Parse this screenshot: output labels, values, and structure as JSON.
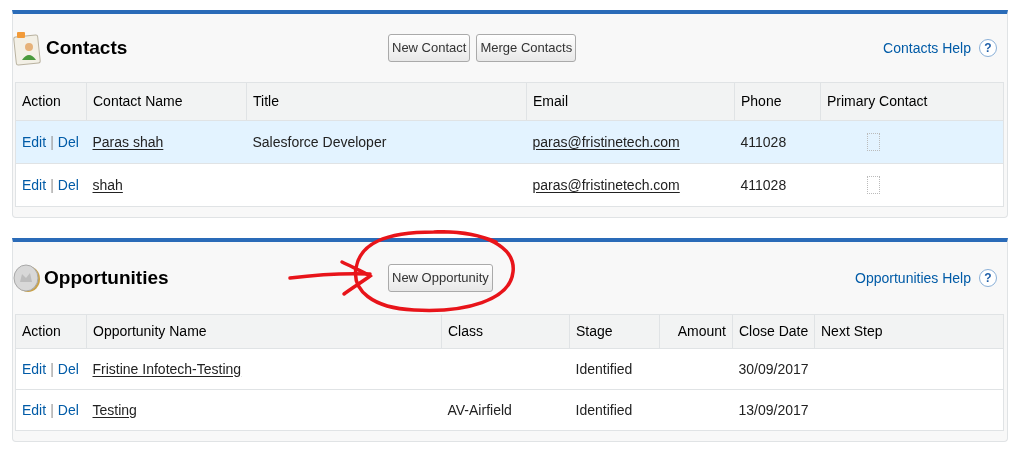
{
  "panels": [
    {
      "kind": "contacts",
      "title": "Contacts",
      "buttons": [
        "New Contact",
        "Merge Contacts"
      ],
      "help": "Contacts Help",
      "help_icon": "?",
      "columns": [
        {
          "label": "Action",
          "kind": "action"
        },
        {
          "label": "Contact Name",
          "kind": "link"
        },
        {
          "label": "Title",
          "kind": "text"
        },
        {
          "label": "Email",
          "kind": "link"
        },
        {
          "label": "Phone",
          "kind": "text"
        },
        {
          "label": "Primary Contact",
          "kind": "checkbox"
        }
      ],
      "rows": [
        {
          "selected": true,
          "cells": [
            {
              "edit": "Edit",
              "separator": "|",
              "delete": "Del"
            },
            "Paras shah",
            "Salesforce Developer",
            "paras@fristinetech.com",
            "411028",
            {
              "checked": false
            }
          ]
        },
        {
          "selected": false,
          "cells": [
            {
              "edit": "Edit",
              "separator": "|",
              "delete": "Del"
            },
            "shah",
            null,
            "paras@fristinetech.com",
            "411028",
            {
              "checked": false
            }
          ]
        }
      ]
    },
    {
      "kind": "opportunities",
      "title": "Opportunities",
      "buttons": [
        "New Opportunity"
      ],
      "help": "Opportunities Help",
      "help_icon": "?",
      "columns": [
        {
          "label": "Action",
          "kind": "action"
        },
        {
          "label": "Opportunity Name",
          "kind": "link"
        },
        {
          "label": "Class",
          "kind": "text"
        },
        {
          "label": "Stage",
          "kind": "text"
        },
        {
          "label": "Amount",
          "kind": "number"
        },
        {
          "label": "Close Date",
          "kind": "text"
        },
        {
          "label": "Next Step",
          "kind": "text"
        }
      ],
      "rows": [
        {
          "selected": false,
          "cells": [
            {
              "edit": "Edit",
              "separator": "|",
              "delete": "Del"
            },
            "Fristine Infotech-Testing",
            null,
            "Identified",
            null,
            "30/09/2017",
            null
          ]
        },
        {
          "selected": false,
          "cells": [
            {
              "edit": "Edit",
              "separator": "|",
              "delete": "Del"
            },
            "Testing",
            "AV-Airfield",
            "Identified",
            null,
            "13/09/2017",
            null
          ]
        }
      ]
    }
  ]
}
